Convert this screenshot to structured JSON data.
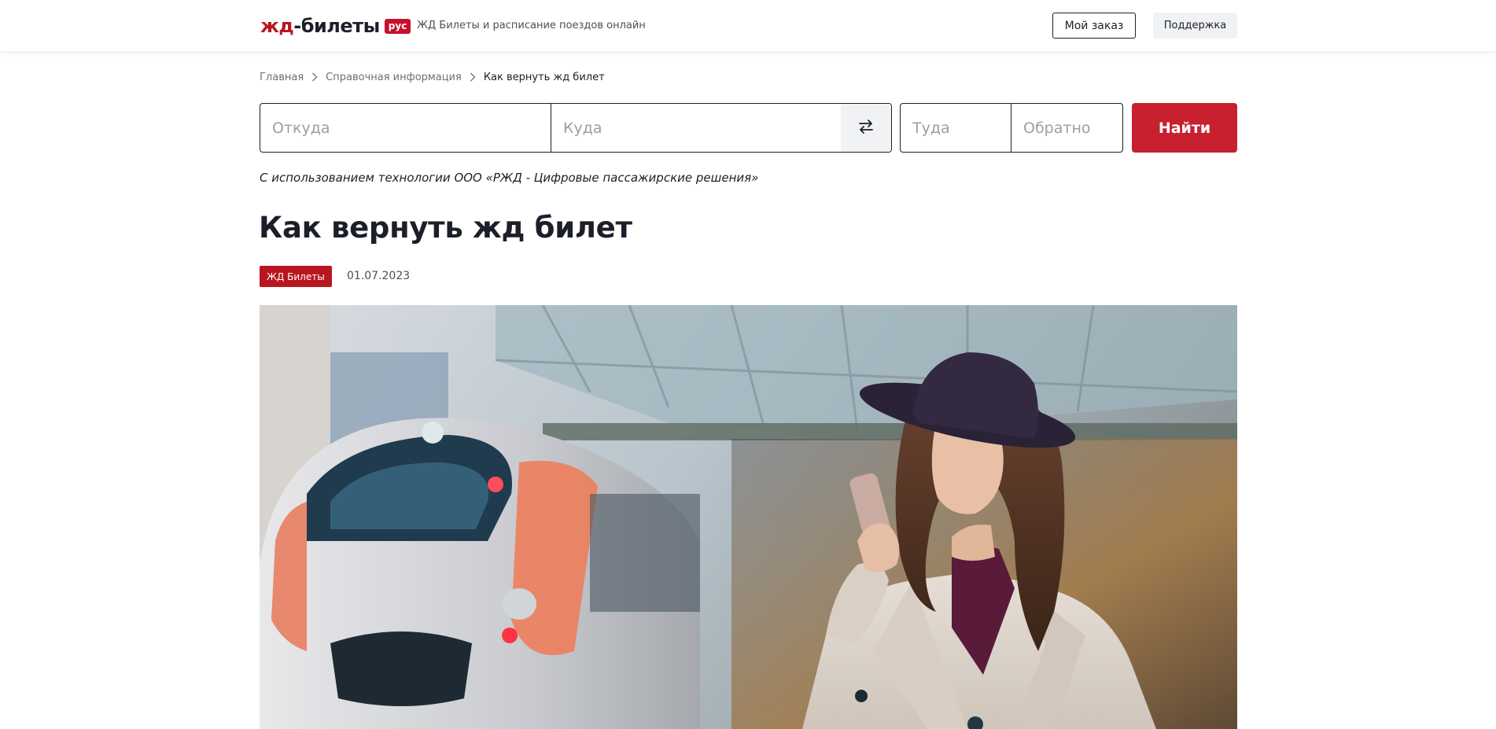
{
  "header": {
    "logo_part1": "жд",
    "logo_part2": "-билеты",
    "logo_badge": "рус",
    "tagline": "ЖД Билеты и расписание поездов онлайн",
    "my_order": "Мой заказ",
    "support": "Поддержка"
  },
  "breadcrumb": {
    "items": [
      "Главная",
      "Справочная информация"
    ],
    "current": "Как вернуть жд билет"
  },
  "search": {
    "from_placeholder": "Откуда",
    "to_placeholder": "Куда",
    "there_placeholder": "Туда",
    "back_placeholder": "Обратно",
    "find_label": "Найти",
    "swap_icon": "swap-arrows-icon"
  },
  "tech_note": "С использованием технологии ООО «РЖД - Цифровые пассажирские решения»",
  "article": {
    "title": "Как вернуть жд билет",
    "tag": "ЖД Билеты",
    "date": "01.07.2023"
  },
  "colors": {
    "brand_red": "#c8202f",
    "text_dark": "#1c1f2a"
  }
}
